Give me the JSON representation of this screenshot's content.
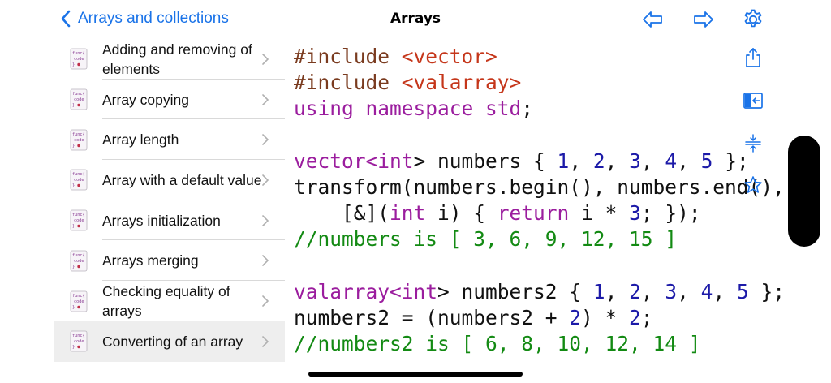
{
  "nav": {
    "back_label": "Arrays and collections",
    "title": "Arrays"
  },
  "sidebar": {
    "items": [
      {
        "label": "Adding and removing of elements",
        "selected": false
      },
      {
        "label": "Array copying",
        "selected": false
      },
      {
        "label": "Array length",
        "selected": false
      },
      {
        "label": "Array with a default value",
        "selected": false
      },
      {
        "label": "Arrays initialization",
        "selected": false
      },
      {
        "label": "Arrays merging",
        "selected": false
      },
      {
        "label": "Checking equality of arrays",
        "selected": false
      },
      {
        "label": "Converting of an array",
        "selected": true
      }
    ],
    "icon_text": "func{ code }"
  },
  "code": {
    "lines": [
      [
        {
          "t": "#include ",
          "c": "pp"
        },
        {
          "t": "<vector>",
          "c": "str"
        }
      ],
      [
        {
          "t": "#include ",
          "c": "pp"
        },
        {
          "t": "<valarray>",
          "c": "str"
        }
      ],
      [
        {
          "t": "using namespace ",
          "c": "kw"
        },
        {
          "t": "std",
          "c": "kw"
        },
        {
          "t": ";",
          "c": ""
        }
      ],
      [],
      [
        {
          "t": "vector<",
          "c": "kw"
        },
        {
          "t": "int",
          "c": "kw"
        },
        {
          "t": "> numbers { ",
          "c": ""
        },
        {
          "t": "1",
          "c": "num"
        },
        {
          "t": ", ",
          "c": ""
        },
        {
          "t": "2",
          "c": "num"
        },
        {
          "t": ", ",
          "c": ""
        },
        {
          "t": "3",
          "c": "num"
        },
        {
          "t": ", ",
          "c": ""
        },
        {
          "t": "4",
          "c": "num"
        },
        {
          "t": ", ",
          "c": ""
        },
        {
          "t": "5",
          "c": "num"
        },
        {
          "t": " };",
          "c": ""
        }
      ],
      [
        {
          "t": "transform(numbers.begin(), numbers.end(), nu",
          "c": ""
        }
      ],
      [
        {
          "t": "    [&](",
          "c": ""
        },
        {
          "t": "int",
          "c": "kw"
        },
        {
          "t": " i) { ",
          "c": ""
        },
        {
          "t": "return",
          "c": "kw"
        },
        {
          "t": " i * ",
          "c": ""
        },
        {
          "t": "3",
          "c": "num"
        },
        {
          "t": "; });",
          "c": ""
        }
      ],
      [
        {
          "t": "//numbers is [ 3, 6, 9, 12, 15 ]",
          "c": "cm"
        }
      ],
      [],
      [
        {
          "t": "valarray<",
          "c": "kw"
        },
        {
          "t": "int",
          "c": "kw"
        },
        {
          "t": "> numbers2 { ",
          "c": ""
        },
        {
          "t": "1",
          "c": "num"
        },
        {
          "t": ", ",
          "c": ""
        },
        {
          "t": "2",
          "c": "num"
        },
        {
          "t": ", ",
          "c": ""
        },
        {
          "t": "3",
          "c": "num"
        },
        {
          "t": ", ",
          "c": ""
        },
        {
          "t": "4",
          "c": "num"
        },
        {
          "t": ", ",
          "c": ""
        },
        {
          "t": "5",
          "c": "num"
        },
        {
          "t": " };",
          "c": ""
        }
      ],
      [
        {
          "t": "numbers2 = (numbers2 + ",
          "c": ""
        },
        {
          "t": "2",
          "c": "num"
        },
        {
          "t": ") * ",
          "c": ""
        },
        {
          "t": "2",
          "c": "num"
        },
        {
          "t": ";",
          "c": ""
        }
      ],
      [
        {
          "t": "//numbers2 is [ 6, 8, 10, 12, 14 ]",
          "c": "cm"
        }
      ]
    ]
  },
  "toolbar": {
    "icons": [
      "back-arrow-icon",
      "forward-arrow-icon",
      "gear-icon"
    ],
    "side_icons": [
      "share-icon",
      "panel-toggle-icon",
      "compress-icon",
      "star-icon"
    ]
  },
  "colors": {
    "accent": "#1a73e8",
    "keyword": "#9b1d9e",
    "preprocessor": "#7a3b1f",
    "string": "#c5361a",
    "number": "#1c1aa8",
    "comment": "#138a13",
    "selected_row": "#eeeeee"
  }
}
